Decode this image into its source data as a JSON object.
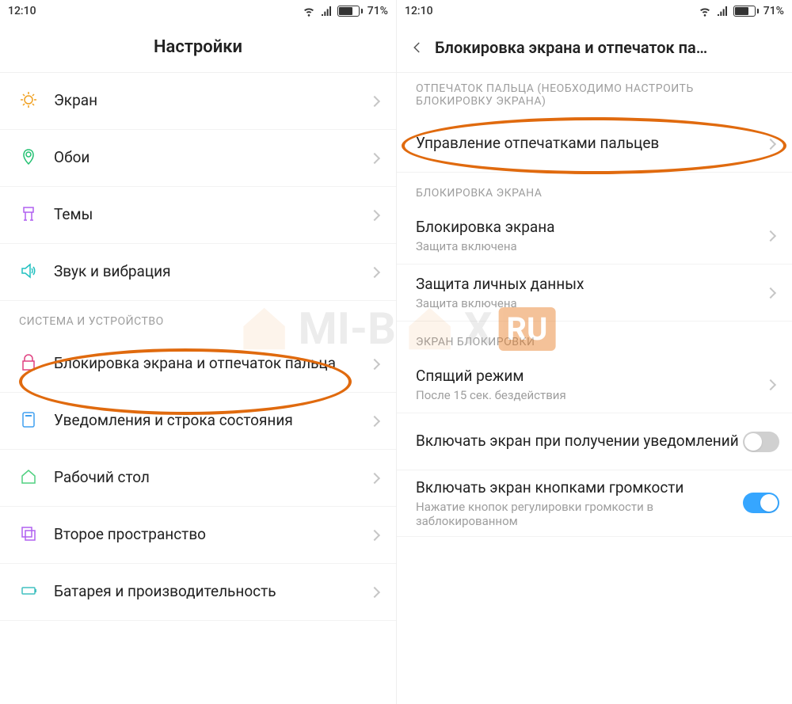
{
  "status": {
    "time": "12:10",
    "battery_pct": "71%",
    "battery_fill": 71
  },
  "left": {
    "title": "Настройки",
    "items": [
      {
        "icon": "display-icon",
        "label": "Экран",
        "color": "#f0a020"
      },
      {
        "icon": "wallpaper-icon",
        "label": "Обои",
        "color": "#20c070"
      },
      {
        "icon": "themes-icon",
        "label": "Темы",
        "color": "#b060f0"
      },
      {
        "icon": "sound-icon",
        "label": "Звук и вибрация",
        "color": "#20c0c0"
      }
    ],
    "section1": "СИСТЕМА И УСТРОЙСТВО",
    "items2": [
      {
        "icon": "lock-icon",
        "label": "Блокировка экрана и отпечаток пальца",
        "color": "#e04080"
      },
      {
        "icon": "notification-icon",
        "label": "Уведомления и строка состояния",
        "color": "#40a0f0"
      },
      {
        "icon": "home-icon",
        "label": "Рабочий стол",
        "color": "#50d080"
      },
      {
        "icon": "second-space-icon",
        "label": "Второе пространство",
        "color": "#b060f0"
      },
      {
        "icon": "battery-icon",
        "label": "Батарея и производительность",
        "color": "#40c0c0"
      }
    ]
  },
  "right": {
    "title": "Блокировка экрана и отпечаток па…",
    "section_fp": "ОТПЕЧАТОК ПАЛЬЦА (НЕОБХОДИМО НАСТРОИТЬ БЛОКИРОВКУ ЭКРАНА)",
    "row_fp_manage": "Управление отпечатками пальцев",
    "section_lock": "БЛОКИРОВКА ЭКРАНА",
    "row_lock": {
      "label": "Блокировка экрана",
      "sub": "Защита включена"
    },
    "row_privacy": {
      "label": "Защита личных данных",
      "sub": "Защита включена"
    },
    "section_screen": "ЭКРАН БЛОКИРОВКИ",
    "row_sleep": {
      "label": "Спящий режим",
      "sub": "После 15 сек. бездействия"
    },
    "row_wake_notif": "Включать экран при получении уведомлений",
    "row_wake_vol": {
      "label": "Включать экран кнопками громкости",
      "sub": "Нажатие кнопок регулировки громкости в заблокированном"
    }
  },
  "watermark": {
    "text_left": "MI-B",
    "text_right": "X",
    "badge": "RU"
  }
}
